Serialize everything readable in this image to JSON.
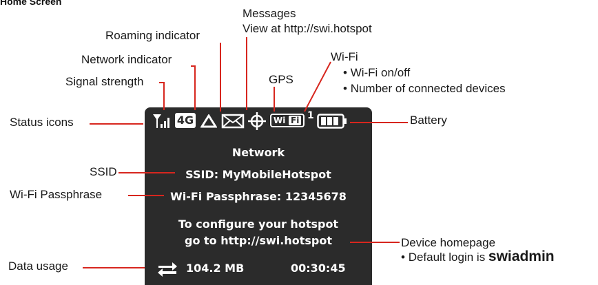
{
  "title": "Home Screen",
  "callouts": {
    "messages_line1": "Messages",
    "messages_line2": "View at http://swi.hotspot",
    "roaming": "Roaming indicator",
    "network": "Network indicator",
    "signal": "Signal strength",
    "gps": "GPS",
    "wifi": "Wi-Fi",
    "wifi_bullets": [
      "Wi-Fi on/off",
      "Number of connected devices"
    ],
    "status_icons": "Status icons",
    "battery": "Battery",
    "ssid": "SSID",
    "passphrase": "Wi-Fi Passphrase",
    "data_usage": "Data usage",
    "device_homepage": "Device homepage",
    "default_login_prefix": "Default login is ",
    "default_login_user": "swiadmin"
  },
  "screen": {
    "network_badge": "4G",
    "wifi_badge_left": "Wi",
    "wifi_badge_right": "Fi",
    "wifi_devices": "1",
    "network_label": "Network",
    "ssid_line": "SSID: MyMobileHotspot",
    "passphrase_line": "Wi-Fi Passphrase: 12345678",
    "configure_line1": "To configure your hotspot",
    "configure_line2": "go to http://swi.hotspot",
    "data_amount": "104.2 MB",
    "timer": "00:30:45"
  },
  "icons": [
    "signal-strength-icon",
    "network-4g-icon",
    "roaming-triangle-icon",
    "envelope-icon",
    "gps-crosshair-icon",
    "wifi-badge-icon",
    "battery-icon",
    "data-transfer-arrows-icon"
  ],
  "colors": {
    "screen_bg": "#2b2b2b",
    "callout_line": "#d7261e",
    "screen_text": "#ffffff"
  }
}
